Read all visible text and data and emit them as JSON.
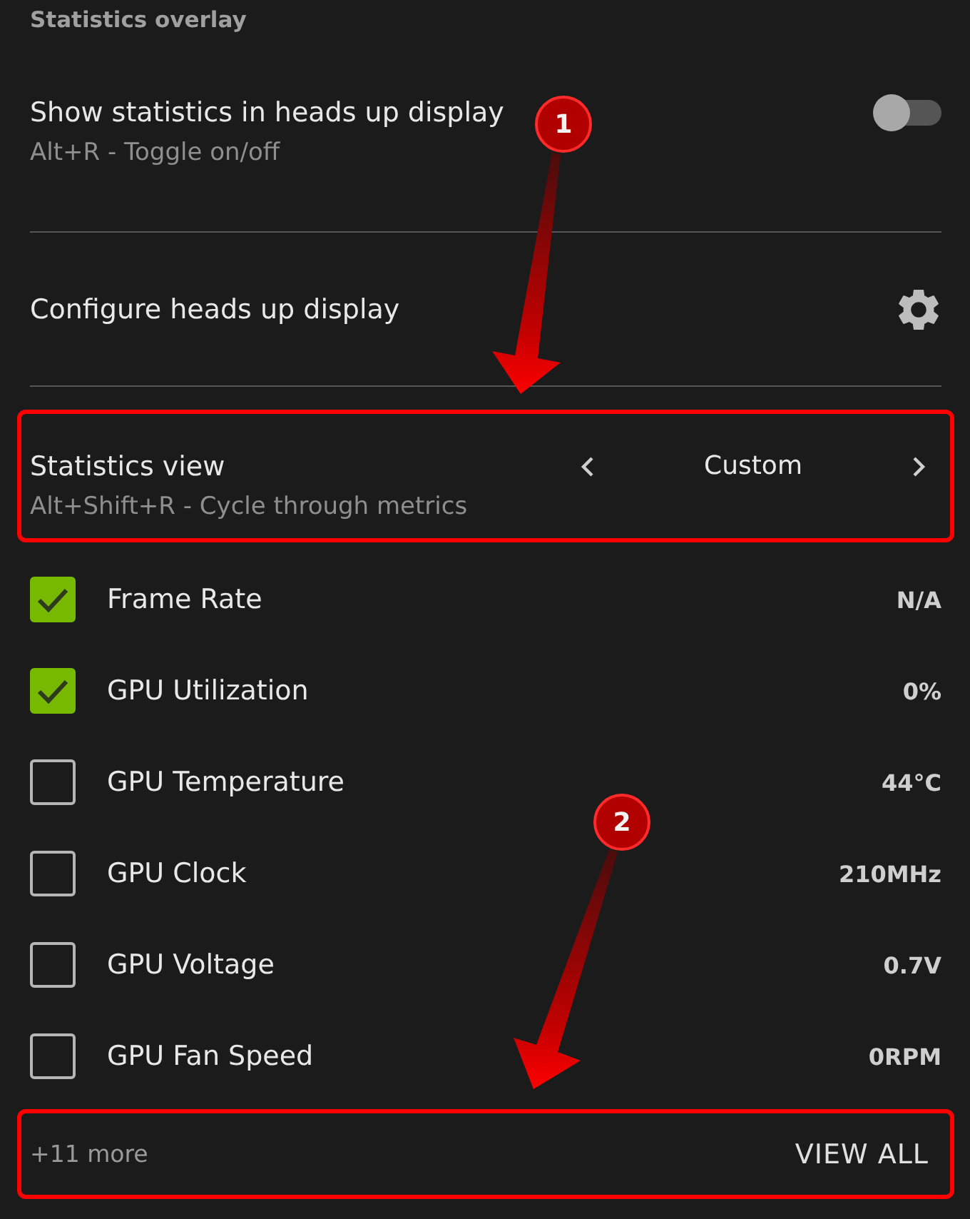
{
  "section_title": "Statistics overlay",
  "hud_toggle": {
    "label": "Show statistics in heads up display",
    "hint": "Alt+R - Toggle on/off",
    "on": false
  },
  "configure": {
    "label": "Configure heads up display"
  },
  "statistics_view": {
    "label": "Statistics view",
    "hint": "Alt+Shift+R - Cycle through metrics",
    "value": "Custom",
    "highlighted": true
  },
  "metrics": [
    {
      "name": "Frame Rate",
      "value": "N/A",
      "checked": true
    },
    {
      "name": "GPU Utilization",
      "value": "0%",
      "checked": true
    },
    {
      "name": "GPU Temperature",
      "value": "44°C",
      "checked": false
    },
    {
      "name": "GPU Clock",
      "value": "210MHz",
      "checked": false
    },
    {
      "name": "GPU Voltage",
      "value": "0.7V",
      "checked": false
    },
    {
      "name": "GPU Fan Speed",
      "value": "0RPM",
      "checked": false
    }
  ],
  "footer": {
    "more": "+11 more",
    "action": "VIEW ALL",
    "highlighted": true
  },
  "callouts": [
    {
      "label": "1"
    },
    {
      "label": "2"
    }
  ]
}
